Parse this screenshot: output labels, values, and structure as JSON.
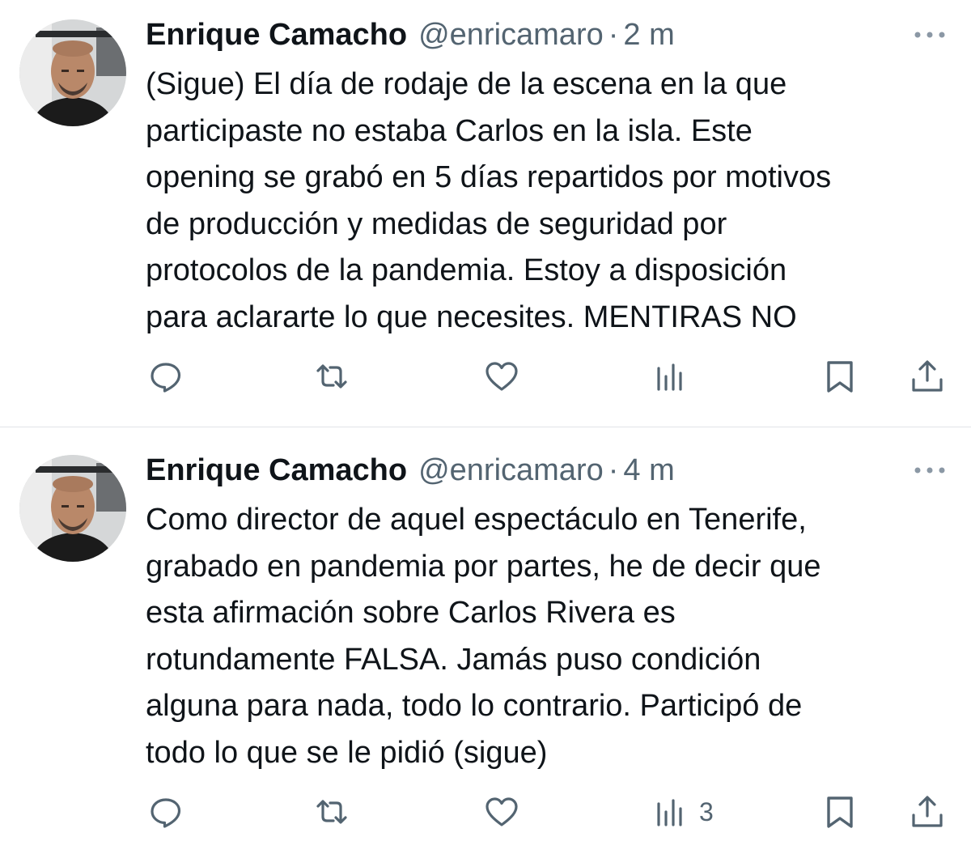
{
  "tweets": [
    {
      "author_name": "Enrique Camacho",
      "handle": "@enricamaro",
      "separator": "·",
      "time": "2 m",
      "text": "(Sigue) El día de rodaje de la escena en la que\nparticipaste no estaba Carlos en la isla. Este\nopening se grabó en 5 días repartidos por motivos\nde producción y medidas de seguridad por\nprotocolos de la pandemia. Estoy a disposición\npara aclararte lo que necesites. MENTIRAS NO",
      "views_count": ""
    },
    {
      "author_name": "Enrique Camacho",
      "handle": "@enricamaro",
      "separator": "·",
      "time": "4 m",
      "text": "Como director de aquel espectáculo en Tenerife,\ngrabado en pandemia por partes, he de decir que\nesta afirmación sobre Carlos Rivera es\nrotundamente FALSA. Jamás puso condición\nalguna para nada, todo lo contrario. Participó de\ntodo lo que se le pidió (sigue)",
      "views_count": "3"
    }
  ],
  "icons": {
    "more": "more-horizontal-icon",
    "reply": "reply-icon",
    "retweet": "retweet-icon",
    "like": "heart-icon",
    "views": "views-icon",
    "bookmark": "bookmark-icon",
    "share": "share-icon"
  },
  "colors": {
    "text": "#0f1419",
    "secondary": "#536471",
    "divider": "#e1e4e8",
    "background": "#ffffff"
  }
}
